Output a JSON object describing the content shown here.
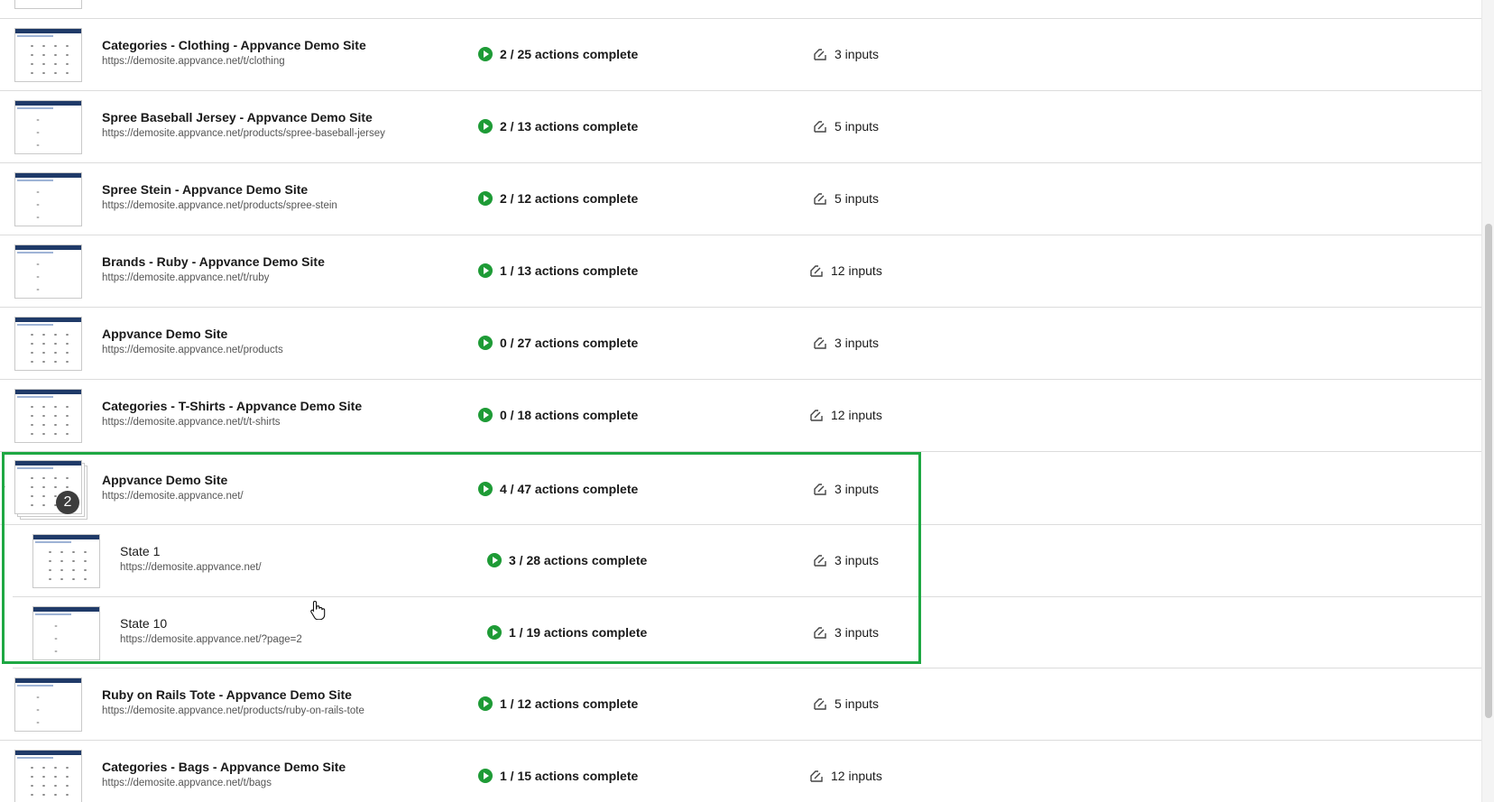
{
  "rows": [
    {
      "title": "Categories - Clothing - Appvance Demo Site",
      "url": "https://demosite.appvance.net/t/clothing",
      "status": "2 / 25 actions complete",
      "inputs": "3 inputs"
    },
    {
      "title": "Spree Baseball Jersey - Appvance Demo Site",
      "url": "https://demosite.appvance.net/products/spree-baseball-jersey",
      "status": "2 / 13 actions complete",
      "inputs": "5 inputs"
    },
    {
      "title": "Spree Stein - Appvance Demo Site",
      "url": "https://demosite.appvance.net/products/spree-stein",
      "status": "2 / 12 actions complete",
      "inputs": "5 inputs"
    },
    {
      "title": "Brands - Ruby - Appvance Demo Site",
      "url": "https://demosite.appvance.net/t/ruby",
      "status": "1 / 13 actions complete",
      "inputs": "12 inputs"
    },
    {
      "title": "Appvance Demo Site",
      "url": "https://demosite.appvance.net/products",
      "status": "0 / 27 actions complete",
      "inputs": "3 inputs"
    },
    {
      "title": "Categories - T-Shirts - Appvance Demo Site",
      "url": "https://demosite.appvance.net/t/t-shirts",
      "status": "0 / 18 actions complete",
      "inputs": "12 inputs"
    },
    {
      "title": "Appvance Demo Site",
      "url": "https://demosite.appvance.net/",
      "status": "4 / 47 actions complete",
      "inputs": "3 inputs",
      "badge": "2"
    },
    {
      "title": "State 1",
      "url": "https://demosite.appvance.net/",
      "status": "3 / 28 actions complete",
      "inputs": "3 inputs"
    },
    {
      "title": "State 10",
      "url": "https://demosite.appvance.net/?page=2",
      "status": "1 / 19 actions complete",
      "inputs": "3 inputs"
    },
    {
      "title": "Ruby on Rails Tote - Appvance Demo Site",
      "url": "https://demosite.appvance.net/products/ruby-on-rails-tote",
      "status": "1 / 12 actions complete",
      "inputs": "5 inputs"
    },
    {
      "title": "Categories - Bags - Appvance Demo Site",
      "url": "https://demosite.appvance.net/t/bags",
      "status": "1 / 15 actions complete",
      "inputs": "12 inputs"
    }
  ],
  "colors": {
    "status_green": "#1e9b36",
    "highlight_green": "#1ea843"
  },
  "icons": {
    "status": "play-circle-icon",
    "inputs": "input-form-icon"
  }
}
